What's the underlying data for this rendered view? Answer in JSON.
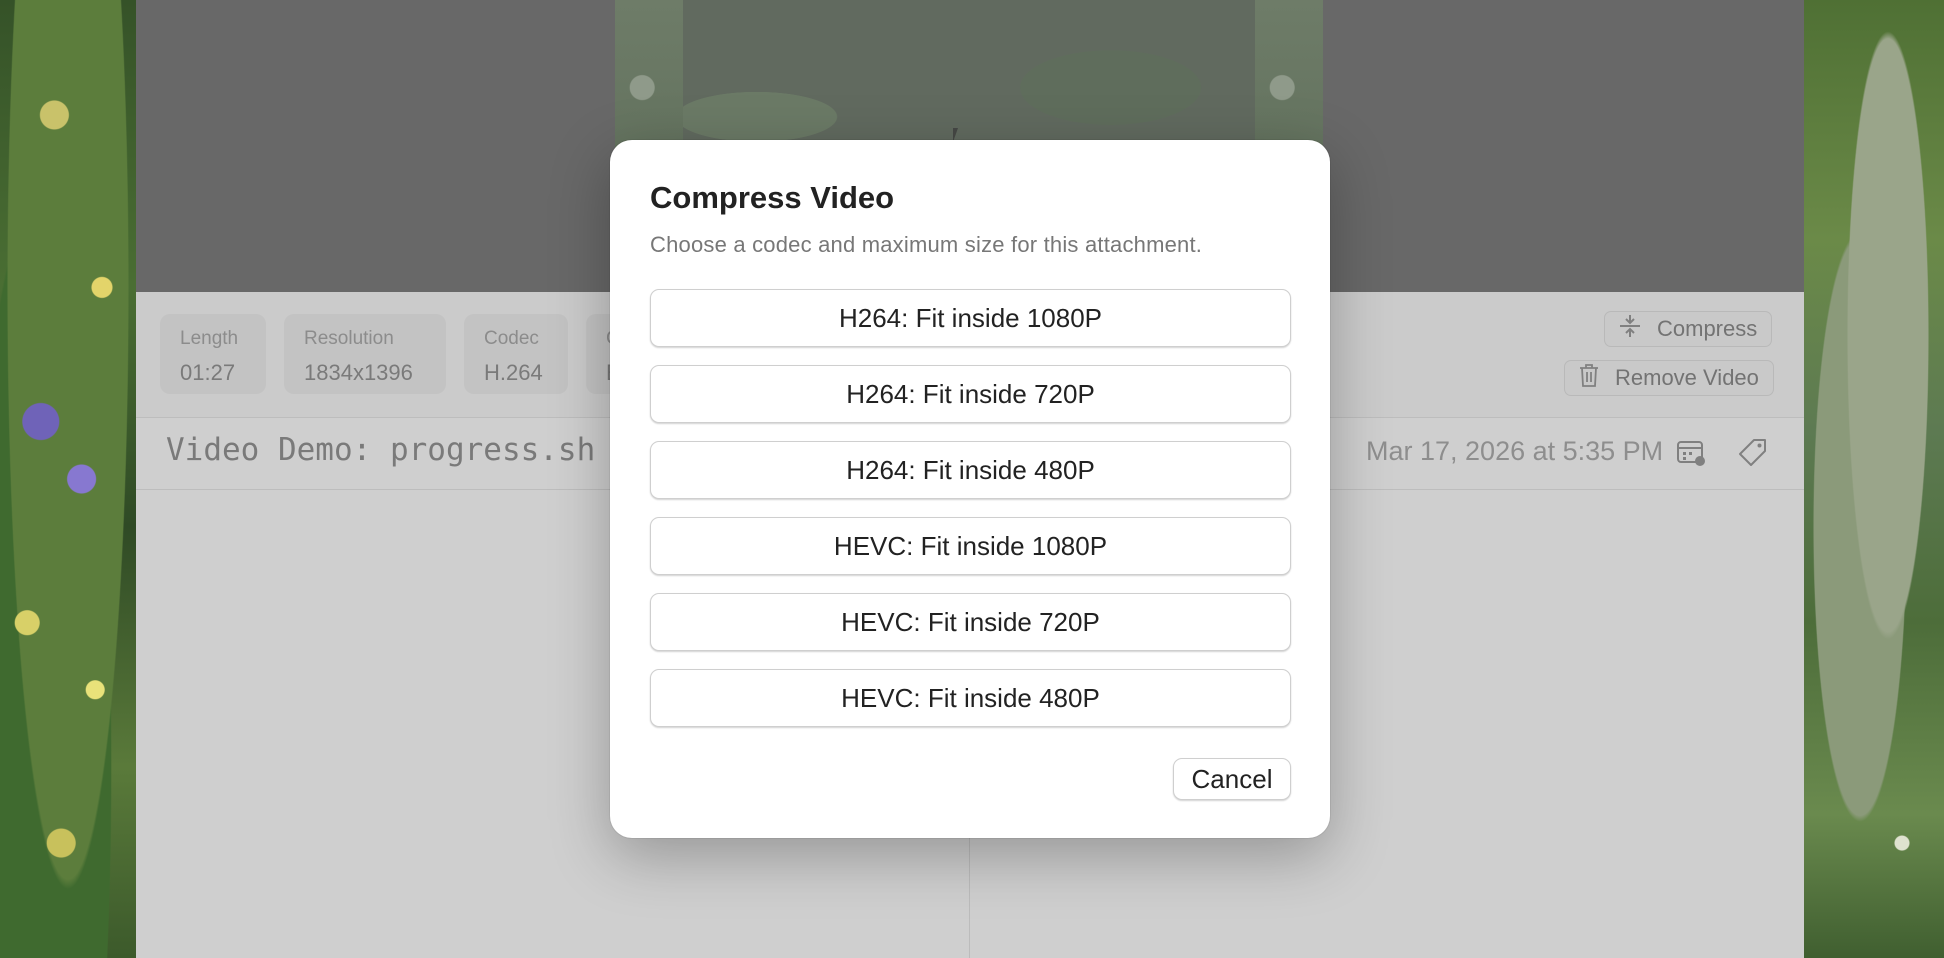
{
  "note": {
    "title": "Video Demo: progress.sh",
    "date": "Mar 17, 2026 at 5:35 PM"
  },
  "video_info": [
    {
      "label": "Length",
      "value": "01:27"
    },
    {
      "label": "Resolution",
      "value": "1834x1396"
    },
    {
      "label": "Codec",
      "value": "H.264"
    },
    {
      "label": "C",
      "value": "E"
    }
  ],
  "actions": {
    "compress": "Compress",
    "remove": "Remove Video"
  },
  "dialog": {
    "title": "Compress Video",
    "subtitle": "Choose a codec and maximum size for this attachment.",
    "options": [
      "H264: Fit inside 1080P",
      "H264: Fit inside 720P",
      "H264: Fit inside 480P",
      "HEVC: Fit inside 1080P",
      "HEVC: Fit inside 720P",
      "HEVC: Fit inside 480P"
    ],
    "cancel": "Cancel"
  },
  "icons": {
    "compress": "compress-icon",
    "trash": "trash-icon",
    "calendar": "calendar-icon",
    "tag": "tag-icon"
  }
}
